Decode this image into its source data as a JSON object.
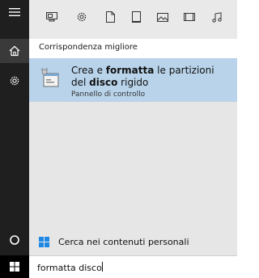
{
  "colors": {
    "sidebar_bg": "#1f1f1f",
    "filter_bg": "#e9e9e9",
    "results_bg": "#e6e6e6",
    "highlight": "#b9d4ea",
    "windows_blue": "#1e88e5"
  },
  "filter_icons": [
    "apps-icon",
    "settings-icon",
    "document-icon",
    "folder-icon",
    "photo-icon",
    "video-icon",
    "music-icon"
  ],
  "section": {
    "header": "Corrispondenza migliore"
  },
  "best_match": {
    "title_pre": "Crea e ",
    "title_bold1": "formatta",
    "title_mid": " le partizioni del ",
    "title_bold2": "disco",
    "title_post": " rigido",
    "subtitle": "Pannello di controllo"
  },
  "personal": {
    "label": "Cerca nei contenuti personali"
  },
  "search": {
    "value": "formatta disco"
  }
}
